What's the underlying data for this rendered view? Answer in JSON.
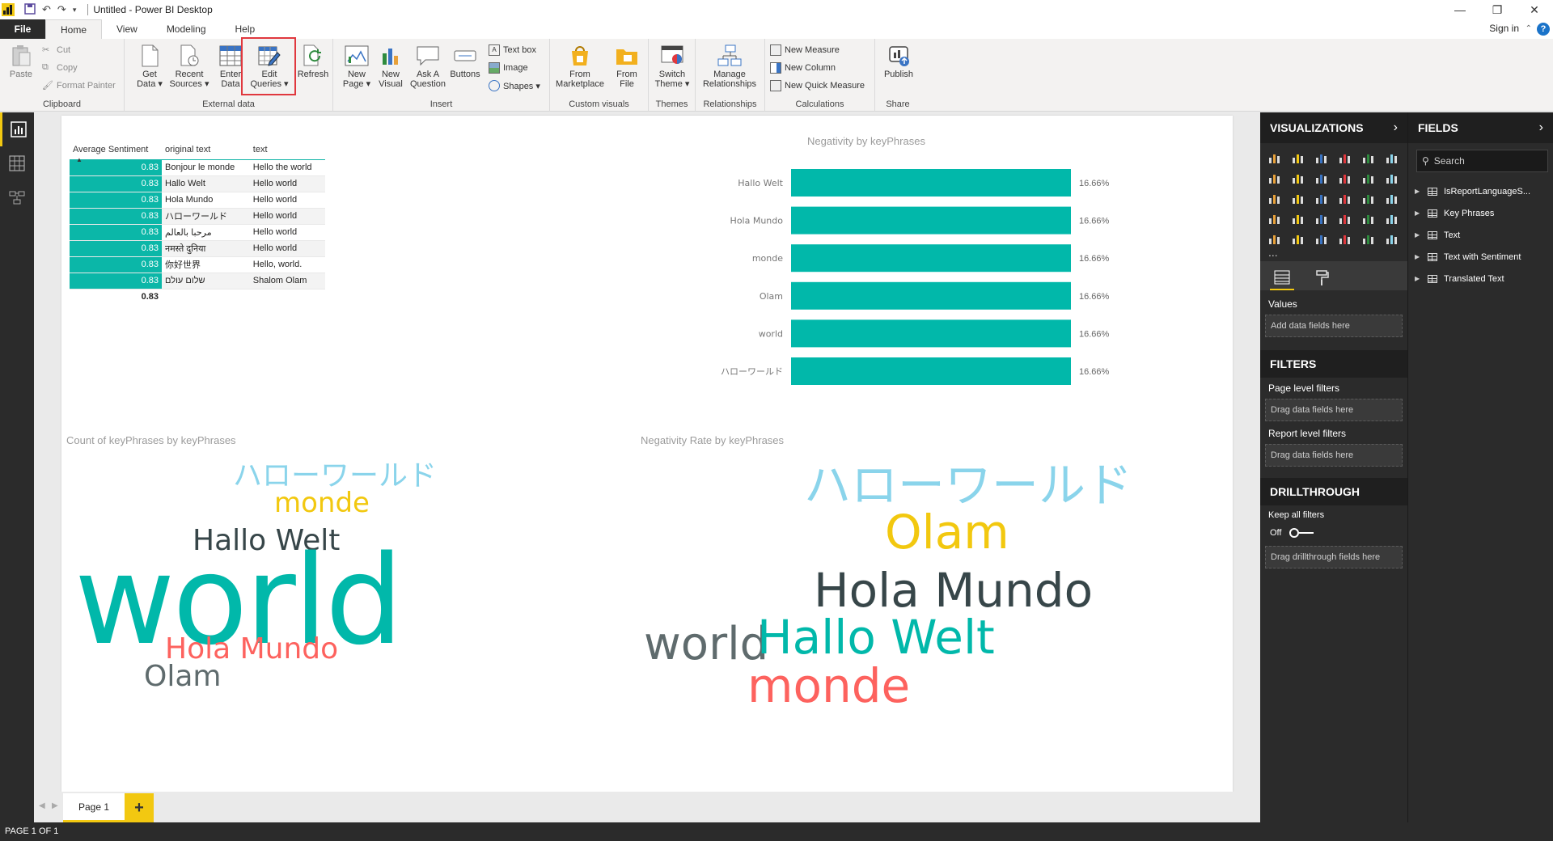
{
  "window": {
    "title": "Untitled - Power BI Desktop",
    "controls": [
      "—",
      "❐",
      "✕"
    ]
  },
  "tabs": [
    {
      "label": "File"
    },
    {
      "label": "Home"
    },
    {
      "label": "View"
    },
    {
      "label": "Modeling"
    },
    {
      "label": "Help"
    }
  ],
  "account": {
    "sign_in": "Sign in",
    "help": "?"
  },
  "ribbon": {
    "clipboard": {
      "label": "Clipboard",
      "paste": "Paste",
      "cut": "Cut",
      "copy": "Copy",
      "format_painter": "Format Painter"
    },
    "external_data": {
      "label": "External data",
      "get_data": [
        "Get",
        "Data ▾"
      ],
      "recent_sources": [
        "Recent",
        "Sources ▾"
      ],
      "enter_data": [
        "Enter",
        "Data"
      ],
      "edit_queries": [
        "Edit",
        "Queries ▾"
      ],
      "refresh": "Refresh"
    },
    "insert": {
      "label": "Insert",
      "new_page": [
        "New",
        "Page ▾"
      ],
      "new_visual": [
        "New",
        "Visual"
      ],
      "ask_question": [
        "Ask A",
        "Question"
      ],
      "buttons": "Buttons",
      "text_box": "Text box",
      "image": "Image",
      "shapes": "Shapes ▾"
    },
    "custom_visuals": {
      "label": "Custom visuals",
      "from_marketplace": [
        "From",
        "Marketplace"
      ],
      "from_file": [
        "From",
        "File"
      ]
    },
    "themes": {
      "label": "Themes",
      "switch_theme": [
        "Switch",
        "Theme ▾"
      ]
    },
    "relationships": {
      "label": "Relationships",
      "manage": [
        "Manage",
        "Relationships"
      ]
    },
    "calculations": {
      "label": "Calculations",
      "new_measure": "New Measure",
      "new_column": "New Column",
      "new_quick_measure": "New Quick Measure"
    },
    "share": {
      "label": "Share",
      "publish": "Publish"
    }
  },
  "table_visual": {
    "headers": [
      "Average Sentiment",
      "original text",
      "text"
    ],
    "rows": [
      {
        "sentiment": "0.83",
        "original": "Bonjour le monde",
        "text": "Hello the world"
      },
      {
        "sentiment": "0.83",
        "original": "Hallo Welt",
        "text": "Hello world"
      },
      {
        "sentiment": "0.83",
        "original": "Hola Mundo",
        "text": "Hello world"
      },
      {
        "sentiment": "0.83",
        "original": "ハローワールド",
        "text": "Hello world"
      },
      {
        "sentiment": "0.83",
        "original": "مرحبا بالعالم",
        "text": "Hello world"
      },
      {
        "sentiment": "0.83",
        "original": "नमस्ते दुनिया",
        "text": "Hello world"
      },
      {
        "sentiment": "0.83",
        "original": "你好世界",
        "text": "Hello, world."
      },
      {
        "sentiment": "0.83",
        "original": "שלום עולם",
        "text": "Shalom Olam"
      }
    ],
    "total": "0.83"
  },
  "chart_data": [
    {
      "type": "bar",
      "orientation": "horizontal",
      "title": "Negativity by keyPhrases",
      "categories": [
        "Hallo Welt",
        "Hola Mundo",
        "monde",
        "Olam",
        "world",
        "ハローワールド"
      ],
      "values": [
        16.66,
        16.66,
        16.66,
        16.66,
        16.66,
        16.66
      ],
      "data_labels": [
        "16.66%",
        "16.66%",
        "16.66%",
        "16.66%",
        "16.66%",
        "16.66%"
      ],
      "bar_color": "#01b8aa",
      "xlim": [
        0,
        16.66
      ]
    }
  ],
  "wordcloud_count": {
    "title": "Count of keyPhrases by keyPhrases",
    "words": [
      "ハローワールド",
      "monde",
      "Hallo Welt",
      "world",
      "Hola Mundo",
      "Olam"
    ]
  },
  "wordcloud_negativity": {
    "title": "Negativity Rate by keyPhrases",
    "words": [
      "ハローワールド",
      "Olam",
      "Hola Mundo",
      "world",
      "Hallo Welt",
      "monde"
    ]
  },
  "colors": {
    "teal": "#01b8aa",
    "yellow": "#f2c80f",
    "red": "#fd625e",
    "dark": "#374649",
    "gray": "#5f6b6d",
    "lightblue": "#8ad4eb",
    "accent": "#f2c811",
    "highlight": "#e0383e"
  },
  "pages": {
    "current": "Page 1",
    "add": "+",
    "status": "PAGE 1 OF 1"
  },
  "visualizations_pane": {
    "title": "VISUALIZATIONS",
    "values_label": "Values",
    "values_well": "Add data fields here",
    "filters_title": "FILTERS",
    "page_filters": "Page level filters",
    "page_filters_well": "Drag data fields here",
    "report_filters": "Report level filters",
    "report_filters_well": "Drag data fields here",
    "drillthrough_title": "DRILLTHROUGH",
    "keep_all_filters": "Keep all filters",
    "toggle_state": "Off",
    "drillthrough_well": "Drag drillthrough fields here",
    "more": "..."
  },
  "fields_pane": {
    "title": "FIELDS",
    "search_placeholder": "Search",
    "tables": [
      "IsReportLanguageS...",
      "Key Phrases",
      "Text",
      "Text with Sentiment",
      "Translated Text"
    ]
  }
}
